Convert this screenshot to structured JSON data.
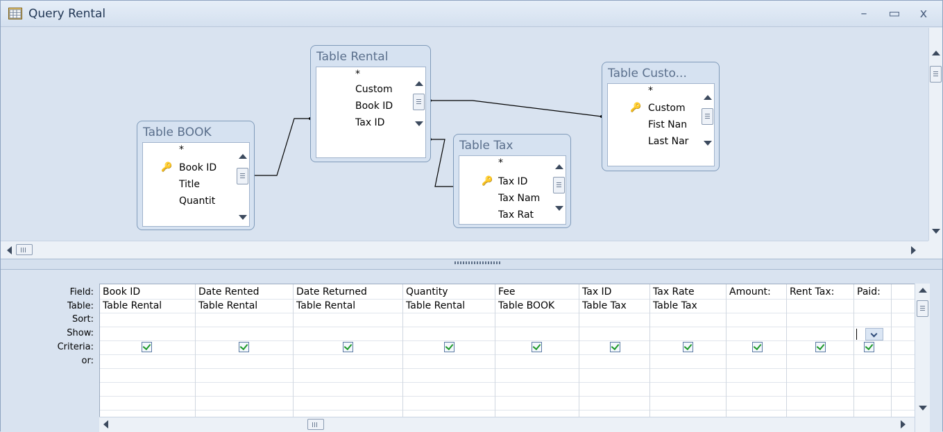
{
  "window": {
    "title": "Query Rental",
    "min_label": "–",
    "max_label": "▭",
    "close_label": "x"
  },
  "tables": {
    "book": {
      "name": "Table BOOK",
      "fields": [
        "*",
        "Book ID",
        "Title",
        "Quantit"
      ],
      "key_field": "Book ID"
    },
    "rental": {
      "name": "Table Rental",
      "fields": [
        "*",
        "Custom",
        "Book ID",
        "Tax ID"
      ]
    },
    "customer": {
      "name": "Table Custo...",
      "fields": [
        "*",
        "Custom",
        "Fist Nan",
        "Last Nar"
      ],
      "key_field": "Custom"
    },
    "tax": {
      "name": "Table Tax",
      "fields": [
        "*",
        "Tax ID",
        "Tax Nam",
        "Tax Rat"
      ],
      "key_field": "Tax ID"
    }
  },
  "grid": {
    "row_labels": [
      "Field:",
      "Table:",
      "Sort:",
      "Show:",
      "Criteria:",
      "or:"
    ],
    "columns": [
      {
        "field": "Book ID",
        "table": "Table Rental",
        "show": true
      },
      {
        "field": "Date Rented",
        "table": "Table Rental",
        "show": true
      },
      {
        "field": "Date Returned",
        "table": "Table Rental",
        "show": true
      },
      {
        "field": "Quantity",
        "table": "Table Rental",
        "show": true
      },
      {
        "field": "Fee",
        "table": "Table BOOK",
        "show": true
      },
      {
        "field": "Tax ID",
        "table": "Table Tax",
        "show": true
      },
      {
        "field": "Tax Rate",
        "table": "Table Tax",
        "show": true
      },
      {
        "field": "Amount:",
        "table": "",
        "show": true
      },
      {
        "field": "Rent Tax:",
        "table": "",
        "show": true
      },
      {
        "field": "Paid:",
        "table": "",
        "show": true
      }
    ]
  },
  "icons": {
    "app": "query-icon",
    "key": "primary-key-icon"
  },
  "colors": {
    "titlebar": "#dbe6f3",
    "background": "#d9e3f0",
    "checkmark": "#1e9a2a"
  }
}
